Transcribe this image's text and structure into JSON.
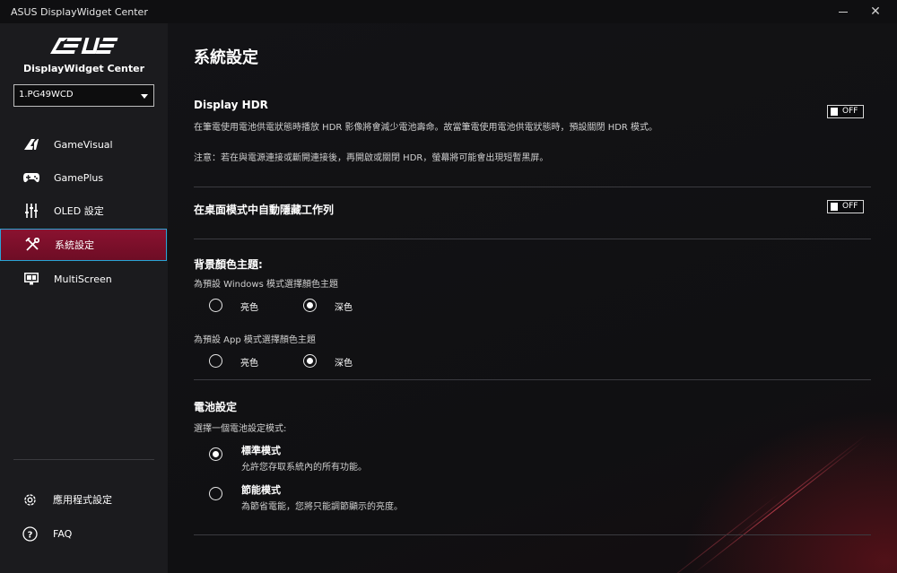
{
  "window": {
    "title": "ASUS DisplayWidget Center"
  },
  "sidebar": {
    "logo_text": "/ISUS",
    "logo_subtitle": "DisplayWidget Center",
    "monitor_select_value": "1.PG49WCD",
    "items": [
      {
        "label": "GameVisual",
        "icon": "gamevisual-icon"
      },
      {
        "label": "GamePlus",
        "icon": "gamepad-icon"
      },
      {
        "label": "OLED 設定",
        "icon": "sliders-icon"
      },
      {
        "label": "系統設定",
        "icon": "tools-icon"
      },
      {
        "label": "MultiScreen",
        "icon": "multiscreen-icon"
      }
    ],
    "bottom": [
      {
        "label": "應用程式設定",
        "icon": "gear-icon"
      },
      {
        "label": "FAQ",
        "icon": "question-icon"
      }
    ]
  },
  "main": {
    "title": "系統設定",
    "hdr": {
      "title": "Display HDR",
      "desc": "在筆電使用電池供電狀態時播放 HDR 影像將會減少電池壽命。故當筆電使用電池供電狀態時，預設關閉 HDR 模式。",
      "note": "注意：若在與電源連接或斷開連接後，再開啟或關閉 HDR，螢幕將可能會出現短暫黑屏。",
      "toggle": "OFF"
    },
    "autohide": {
      "title": "在桌面模式中自動隱藏工作列",
      "toggle": "OFF"
    },
    "theme": {
      "title": "背景顏色主題:",
      "windows_label": "為預設 Windows 模式選擇顏色主題",
      "app_label": "為預設 App 模式選擇顏色主題",
      "light": "亮色",
      "dark": "深色"
    },
    "battery": {
      "title": "電池設定",
      "subtitle": "選擇一個電池設定模式:",
      "standard_title": "標準模式",
      "standard_desc": "允許您存取系統內的所有功能。",
      "eco_title": "節能模式",
      "eco_desc": "為節省電能，您將只能調節顯示的亮度。"
    }
  }
}
